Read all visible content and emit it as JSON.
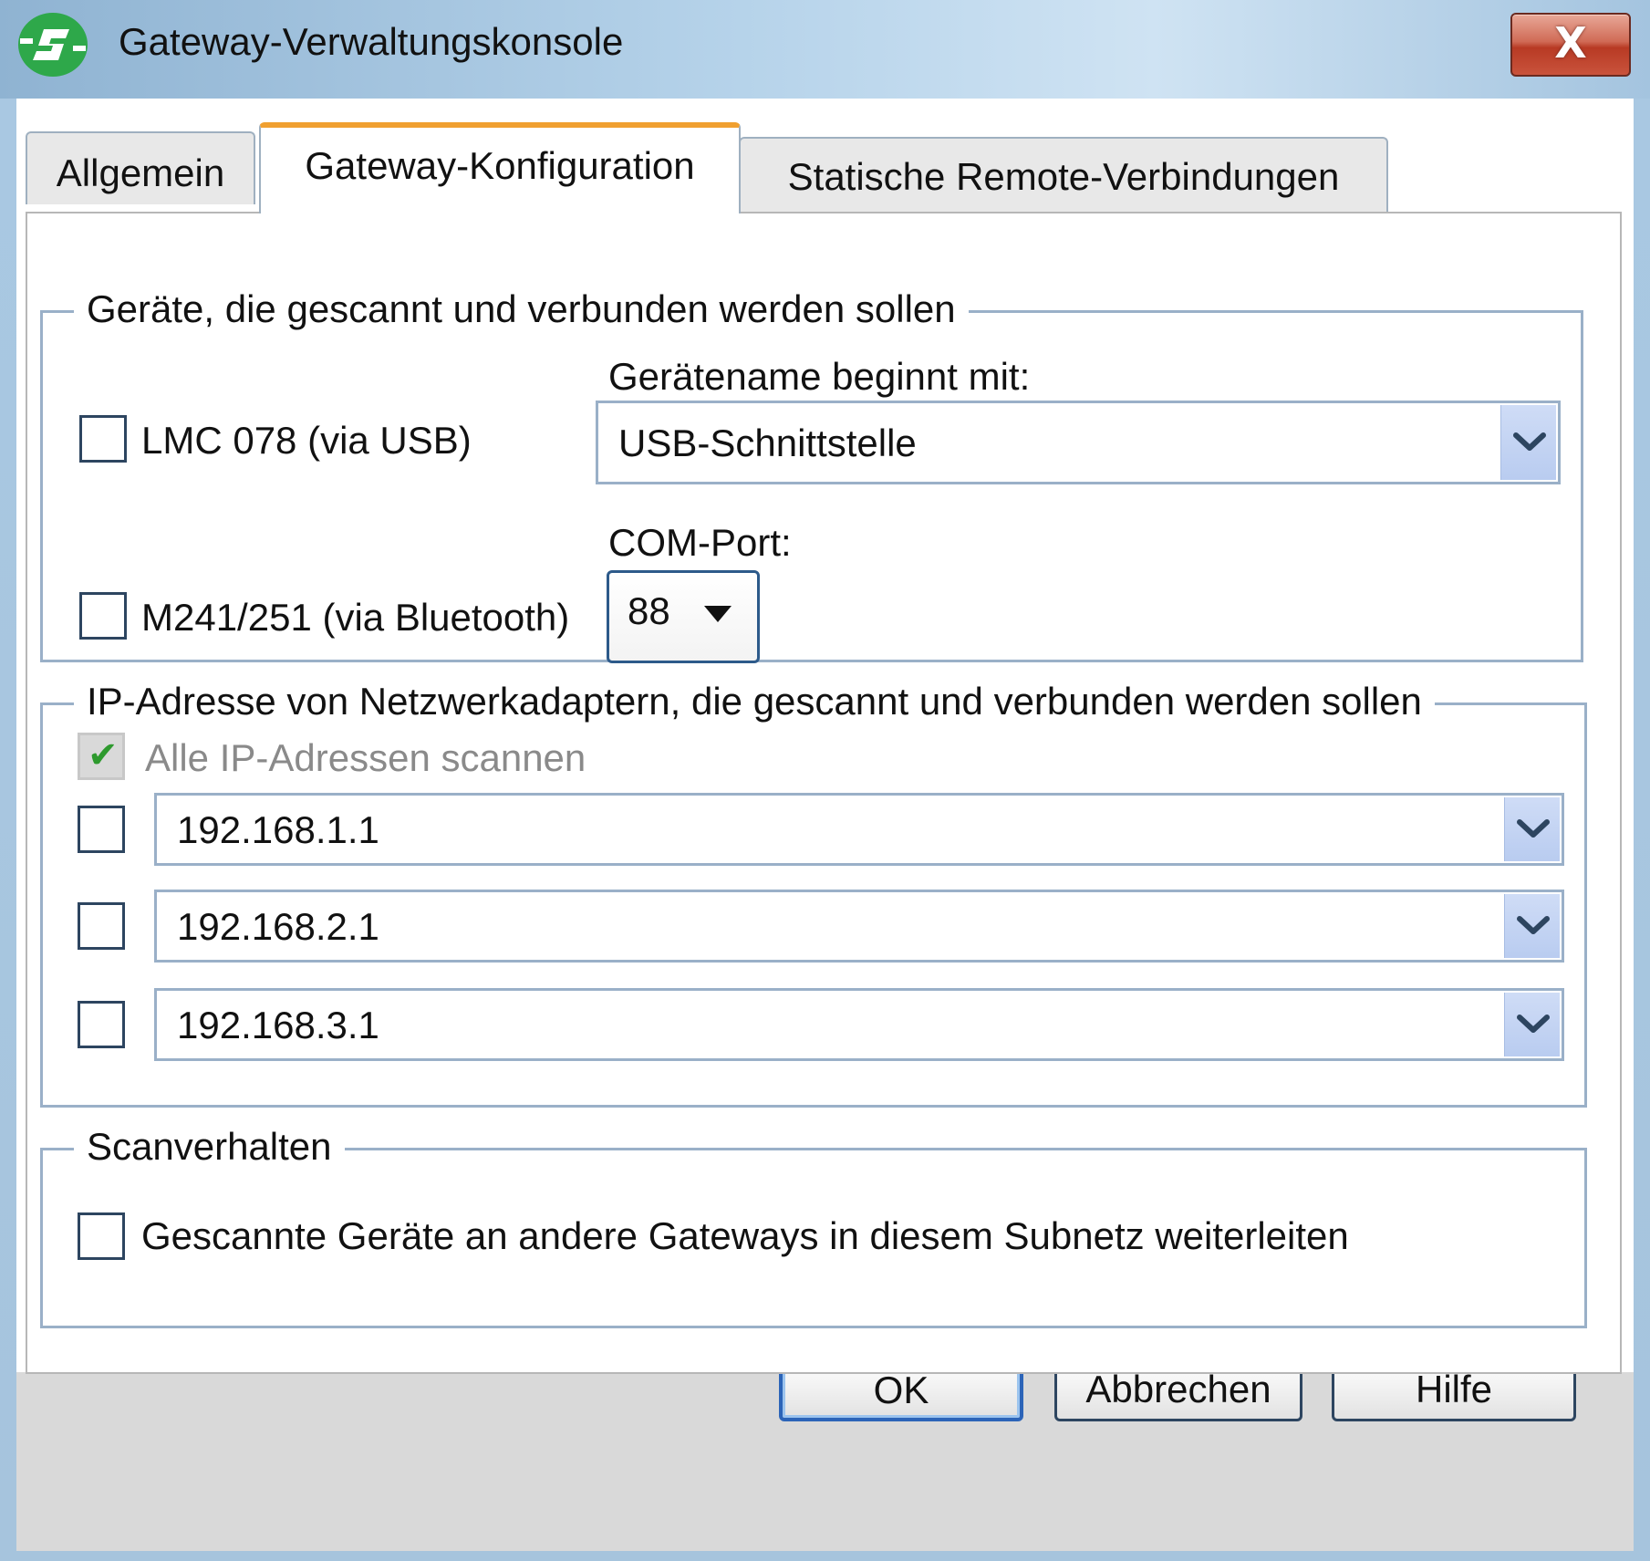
{
  "window": {
    "title": "Gateway-Verwaltungskonsole",
    "close_label": "X",
    "accent_color": "#f0a030",
    "logo_color": "#2ea84a"
  },
  "tabs": [
    {
      "label": "Allgemein",
      "selected": false
    },
    {
      "label": "Gateway-Konfiguration",
      "selected": true
    },
    {
      "label": "Statische Remote-Verbindungen",
      "selected": false
    }
  ],
  "devices_group": {
    "legend": "Geräte, die gescannt und verbunden werden sollen",
    "device_name_label": "Gerätename beginnt mit:",
    "lmc": {
      "label": "LMC 078 (via USB)",
      "checked": false
    },
    "device_name_value": "USB-Schnittstelle",
    "com_port_label": "COM-Port:",
    "m241": {
      "label": "M241/251 (via Bluetooth)",
      "checked": false
    },
    "com_port_value": "88"
  },
  "ip_group": {
    "legend": "IP-Adresse von Netzwerkadaptern, die gescannt und verbunden werden sollen",
    "scan_all": {
      "label": "Alle IP-Adressen scannen",
      "checked": true,
      "disabled": true
    },
    "adapters": [
      {
        "value": "192.168.1.1",
        "checked": false
      },
      {
        "value": "192.168.2.1",
        "checked": false
      },
      {
        "value": "192.168.3.1",
        "checked": false
      }
    ]
  },
  "scan_group": {
    "legend": "Scanverhalten",
    "forward": {
      "label": "Gescannte Geräte an andere Gateways in diesem Subnetz weiterleiten",
      "checked": false
    }
  },
  "buttons": {
    "ok": "OK",
    "cancel": "Abbrechen",
    "help": "Hilfe"
  }
}
